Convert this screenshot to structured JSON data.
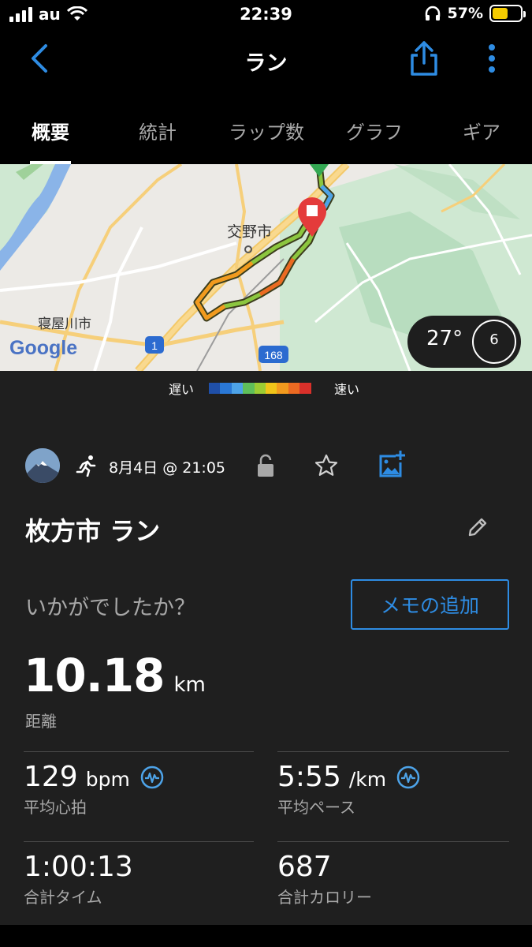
{
  "status_bar": {
    "carrier": "au",
    "time": "22:39",
    "battery": "57%"
  },
  "nav": {
    "title": "ラン"
  },
  "tabs": [
    {
      "label": "概要",
      "active": true
    },
    {
      "label": "統計",
      "active": false
    },
    {
      "label": "ラップ数",
      "active": false
    },
    {
      "label": "グラフ",
      "active": false
    },
    {
      "label": "ギア",
      "active": false
    }
  ],
  "map": {
    "labels": {
      "city1": "交野市",
      "city2": "寝屋川市",
      "route1": "1",
      "route2": "168",
      "brand": "Google"
    },
    "weather": {
      "temperature": "27°",
      "wind": "6"
    }
  },
  "legend": {
    "slow": "遅い",
    "fast": "速い",
    "colors": [
      "#1f4fa8",
      "#2a78d6",
      "#4da3e8",
      "#5fbf5a",
      "#9ccc33",
      "#f0c419",
      "#f29a1e",
      "#ec6a22",
      "#d9302a"
    ]
  },
  "activity": {
    "date": "8月4日 @ 21:05",
    "title": "枚方市 ラン",
    "prompt": "いかがでしたか？",
    "memo_button": "メモの追加",
    "distance": {
      "value": "10.18",
      "unit": "km",
      "label": "距離"
    },
    "stats": [
      {
        "value": "129",
        "unit": "bpm",
        "label": "平均心拍",
        "badge": true
      },
      {
        "value": "5:55",
        "unit": "/km",
        "label": "平均ペース",
        "badge": true
      },
      {
        "value": "1:00:13",
        "unit": "",
        "label": "合計タイム",
        "badge": false
      },
      {
        "value": "687",
        "unit": "",
        "label": "合計カロリー",
        "badge": false
      }
    ]
  },
  "colors": {
    "accent": "#2e8ce3",
    "background": "#000000",
    "panel": "#1f1f1f"
  }
}
